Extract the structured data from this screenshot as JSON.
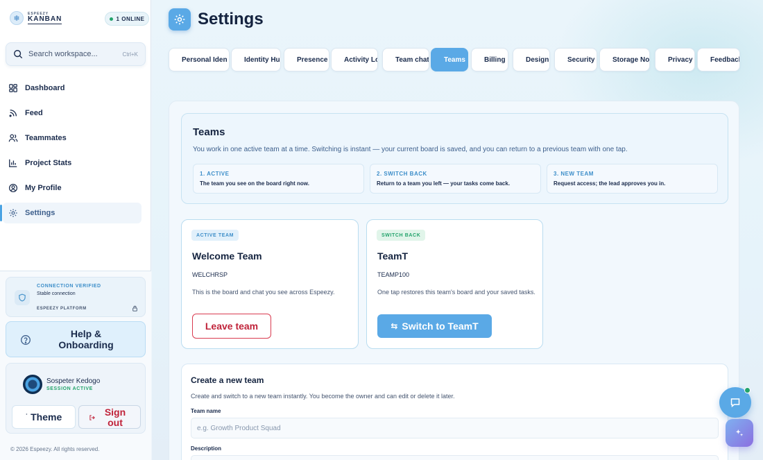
{
  "brand": {
    "small": "ESPEEZY",
    "name": "KANBAN"
  },
  "status": {
    "online": "1 ONLINE"
  },
  "search": {
    "placeholder": "Search workspace...",
    "shortcut": "Ctrl+K"
  },
  "nav": {
    "items": [
      {
        "label": "Dashboard",
        "icon": "dashboard-icon"
      },
      {
        "label": "Feed",
        "icon": "rss-icon"
      },
      {
        "label": "Teammates",
        "icon": "users-icon"
      },
      {
        "label": "Project Stats",
        "icon": "bar-chart-icon"
      },
      {
        "label": "My Profile",
        "icon": "user-circle-icon"
      },
      {
        "label": "Settings",
        "icon": "gear-icon",
        "active": true
      }
    ]
  },
  "connection": {
    "title": "CONNECTION VERIFIED",
    "subtitle": "Stable connection",
    "platform": "ESPEEZY PLATFORM"
  },
  "help": {
    "label": "Help & Onboarding"
  },
  "user": {
    "name": "Sospeter Kedogo",
    "status": "SESSION ACTIVE"
  },
  "actions": {
    "theme": "Theme",
    "signout": "Sign out"
  },
  "footer": {
    "copyright": "© 2026 Espeezy. All rights reserved."
  },
  "page": {
    "title": "Settings"
  },
  "tabs": [
    {
      "label": "Personal Iden"
    },
    {
      "label": "Identity Hu"
    },
    {
      "label": "Presence"
    },
    {
      "label": "Activity Log"
    },
    {
      "label": "Team chat"
    },
    {
      "label": "Teams",
      "active": true
    },
    {
      "label": "Billing"
    },
    {
      "label": "Design"
    },
    {
      "label": "Security"
    },
    {
      "label": "Storage Nod"
    },
    {
      "label": "Privacy"
    },
    {
      "label": "Feedback"
    }
  ],
  "teams_intro": {
    "title": "Teams",
    "text": "You work in one active team at a time. Switching is instant — your current board is saved, and you can return to a previous team with one tap.",
    "steps": [
      {
        "label": "1. ACTIVE",
        "text": "The team you see on the board right now."
      },
      {
        "label": "2. SWITCH BACK",
        "text": "Return to a team you left — your tasks come back."
      },
      {
        "label": "3. NEW TEAM",
        "text": "Request access; the lead approves you in."
      }
    ]
  },
  "active_team": {
    "badge": "ACTIVE TEAM",
    "name": "Welcome Team",
    "code": "WELCHRSP",
    "description": "This is the board and chat you see across Espeezy.",
    "button": "Leave team"
  },
  "switch_team": {
    "badge": "SWITCH BACK",
    "name": "TeamT",
    "code": "TEAMP100",
    "description": "One tap restores this team's board and your saved tasks.",
    "button": "Switch to TeamT"
  },
  "create_team": {
    "title": "Create a new team",
    "subtitle": "Create and switch to a new team instantly. You become the owner and can edit or delete it later.",
    "name_label": "Team name",
    "name_placeholder": "e.g. Growth Product Squad",
    "desc_label": "Description"
  },
  "colors": {
    "accent": "#5aa9e6",
    "danger": "#c0233a",
    "success": "#23a36b",
    "text": "#1a2b4c"
  }
}
